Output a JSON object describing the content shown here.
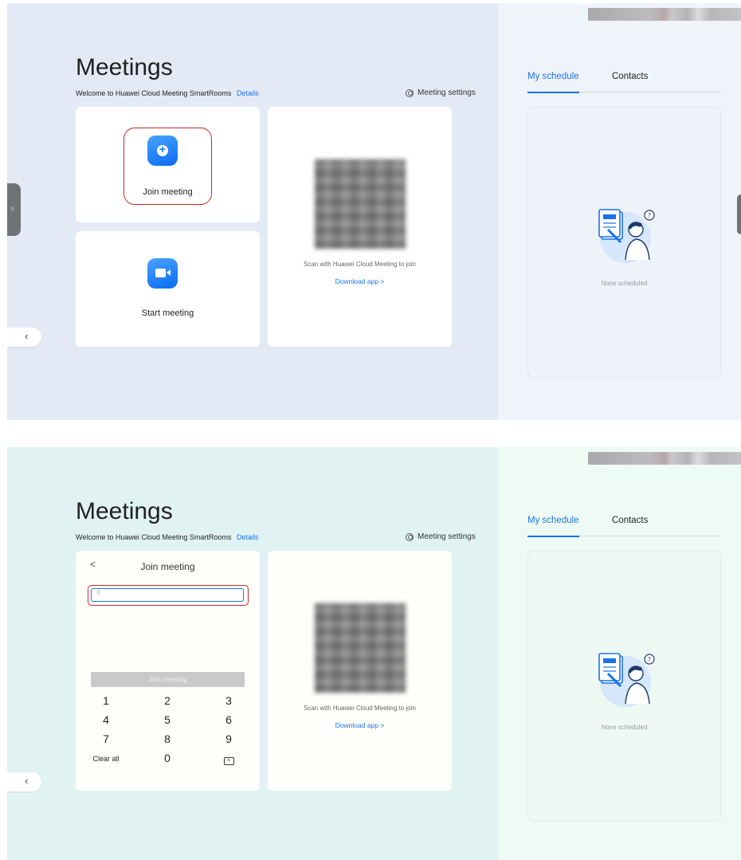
{
  "screens": [
    {
      "title": "Meetings",
      "welcome": "Welcome to Huawei Cloud Meeting SmartRooms",
      "details_link": "Details",
      "settings_label": "Meeting settings",
      "join_label": "Join meeting",
      "start_label": "Start meeting",
      "scan_text": "Scan with Huawei Cloud Meeting to join",
      "download_link": "Download app >",
      "tabs": [
        "My schedule",
        "Contacts"
      ],
      "none_scheduled": "None scheduled"
    },
    {
      "title": "Meetings",
      "welcome": "Welcome to Huawei Cloud Meeting SmartRooms",
      "details_link": "Details",
      "settings_label": "Meeting settings",
      "join_panel": {
        "back": "<",
        "title": "Join meeting",
        "input_value": "",
        "join_button": "Join meeting",
        "keys": [
          "1",
          "2",
          "3",
          "4",
          "5",
          "6",
          "7",
          "8",
          "9",
          "Clear all",
          "0"
        ]
      },
      "scan_text": "Scan with Huawei Cloud Meeting to join",
      "download_link": "Download app >",
      "tabs": [
        "My schedule",
        "Contacts"
      ],
      "none_scheduled": "None scheduled"
    }
  ],
  "icons": {
    "join": "plus-icon",
    "start": "video-camera-icon",
    "settings": "gear-icon",
    "keypad": "keypad-icon",
    "backspace": "backspace-icon",
    "back": "chevron-left-icon"
  },
  "colors": {
    "accent": "#1a73e8",
    "highlight": "#c8282c",
    "screen1_bg": "#e3eaf6",
    "screen2_bg": "#e1f2f2"
  }
}
